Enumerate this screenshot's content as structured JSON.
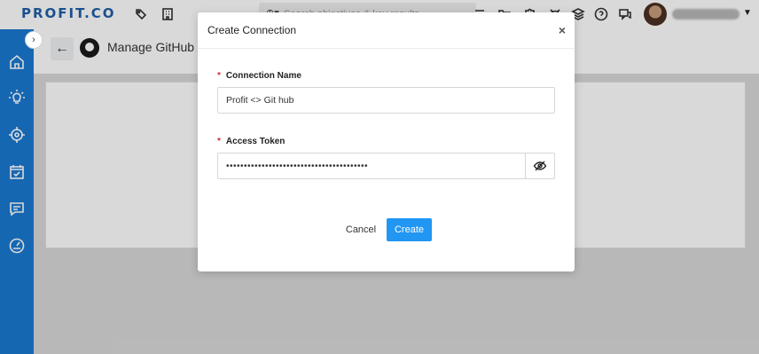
{
  "app": {
    "logo": "PROFIT.CO",
    "search_placeholder": "Search objectives & key results"
  },
  "page": {
    "title": "Manage GitHub Connections"
  },
  "modal": {
    "title": "Create Connection",
    "close_glyph": "×",
    "fields": {
      "connection_name": {
        "label": "Connection Name",
        "required_mark": "*",
        "value": "Profit <> Git hub"
      },
      "access_token": {
        "label": "Access Token",
        "required_mark": "*",
        "value": "••••••••••••••••••••••••••••••••••••••••"
      }
    },
    "buttons": {
      "cancel": "Cancel",
      "create": "Create"
    }
  },
  "colors": {
    "accent": "#2196f3",
    "sidebar": "#1a79d2",
    "required": "#d32f2f",
    "logo": "#1f5fa8"
  },
  "icons": {
    "topbar": [
      "tag-icon",
      "building-icon",
      "target-dropdown-icon",
      "filter-icon",
      "folder-icon",
      "puzzle-icon",
      "alarm-icon",
      "layers-icon",
      "help-icon",
      "chat-icon"
    ],
    "sidebar": [
      "home-icon",
      "lightbulb-icon",
      "target-icon",
      "checklist-icon",
      "feedback-icon",
      "dashboard-icon"
    ],
    "eye": "eye-off-icon"
  }
}
